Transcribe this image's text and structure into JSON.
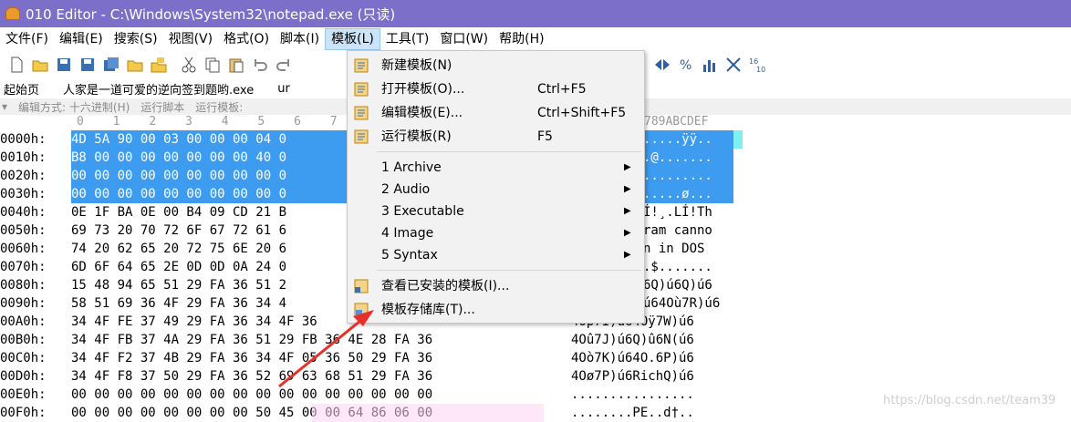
{
  "window": {
    "title": "010 Editor - C:\\Windows\\System32\\notepad.exe (只读)"
  },
  "menu": [
    "文件(F)",
    "编辑(E)",
    "搜索(S)",
    "视图(V)",
    "格式(O)",
    "脚本(I)",
    "模板(L)",
    "工具(T)",
    "窗口(W)",
    "帮助(H)"
  ],
  "tabs": [
    "起始页",
    "人家是一道可爱的逆向签到题哟.exe",
    "ur"
  ],
  "subbar": {
    "edit_mode": "编辑方式: 十六进制(H)",
    "run_script": "运行脚本",
    "run_template": "运行模板:"
  },
  "columns": {
    "left": "0  1  2  3  4  5  6  7  8",
    "right": "789ABCDEF"
  },
  "rows": [
    {
      "addr": "0000h:",
      "bytes": "4D 5A 90 00 03 00 00 00 04 0",
      "ascii": ".....ÿÿ.."
    },
    {
      "addr": "0010h:",
      "bytes": "B8 00 00 00 00 00 00 00 40 0",
      "ascii": ".@......."
    },
    {
      "addr": "0020h:",
      "bytes": "00 00 00 00 00 00 00 00 00 0",
      "ascii": "........."
    },
    {
      "addr": "0030h:",
      "bytes": "00 00 00 00 00 00 00 00 00 0",
      "ascii": ".....ø..."
    },
    {
      "addr": "0040h:",
      "bytes": "0E 1F BA 0E 00 B4 09 CD 21 B",
      "ascii": "Í!¸.LÍ!Th"
    },
    {
      "addr": "0050h:",
      "bytes": "69 73 20 70 72 6F 67 72 61 6",
      "ascii": "ram canno"
    },
    {
      "addr": "0060h:",
      "bytes": "74 20 62 65 20 72 75 6E 20 6",
      "ascii": "n in DOS "
    },
    {
      "addr": "0070h:",
      "bytes": "6D 6F 64 65 2E 0D 0D 0A 24 0",
      "ascii": ".$......."
    },
    {
      "addr": "0080h:",
      "bytes": "15 48 94 65 51 29 FA 36 51 2",
      "ascii": "6Q)ú6Q)ú6"
    },
    {
      "addr": "0090h:",
      "bytes": "58 51 69 36 4F 29 FA 36 34 4",
      "ascii": "ú64Où7R)ú6"
    },
    {
      "addr": "00A0h:",
      "bytes": "34 4F FE 37 49 29 FA 36 34 4F 36",
      "ascii": "4Oþ7I)ú64Oÿ7W)ú6"
    },
    {
      "addr": "00B0h:",
      "bytes": "34 4F FB 37 4A 29 FA 36 51 29 FB 36 4E 28 FA 36",
      "ascii": "4Oû7J)ú6Q)û6N(ú6"
    },
    {
      "addr": "00C0h:",
      "bytes": "34 4F F2 37 4B 29 FA 36 34 4F 05 36 50 29 FA 36",
      "ascii": "4Oò7K)ú64O.6P)ú6"
    },
    {
      "addr": "00D0h:",
      "bytes": "34 4F F8 37 50 29 FA 36 52 69 63 68 51 29 FA 36",
      "ascii": "4Oø7P)ú6RichQ)ú6"
    },
    {
      "addr": "00E0h:",
      "bytes": "00 00 00 00 00 00 00 00 00 00 00 00 00 00 00 00",
      "ascii": "................"
    },
    {
      "addr": "00F0h:",
      "bytes": "00 00 00 00 00 00 00 00 50 45 00 00 64 86 06 00",
      "ascii": "........PE..d†.."
    }
  ],
  "dropdown": {
    "items": [
      {
        "label": "新建模板(N)",
        "shortcut": ""
      },
      {
        "label": "打开模板(O)...",
        "shortcut": "Ctrl+F5"
      },
      {
        "label": "编辑模板(E)...",
        "shortcut": "Ctrl+Shift+F5"
      },
      {
        "label": "运行模板(R)",
        "shortcut": "F5"
      },
      {
        "label": "1 Archive",
        "shortcut": ""
      },
      {
        "label": "2 Audio",
        "shortcut": ""
      },
      {
        "label": "3 Executable",
        "shortcut": ""
      },
      {
        "label": "4 Image",
        "shortcut": ""
      },
      {
        "label": "5 Syntax",
        "shortcut": ""
      },
      {
        "label": "查看已安装的模板(I)...",
        "shortcut": ""
      },
      {
        "label": "模板存储库(T)...",
        "shortcut": ""
      }
    ]
  },
  "watermark": "https://blog.csdn.net/team39",
  "colors": {
    "titlebar": "#7b6fc9",
    "selection": "#3d9bf0",
    "highlight": "#fbd3f4"
  }
}
